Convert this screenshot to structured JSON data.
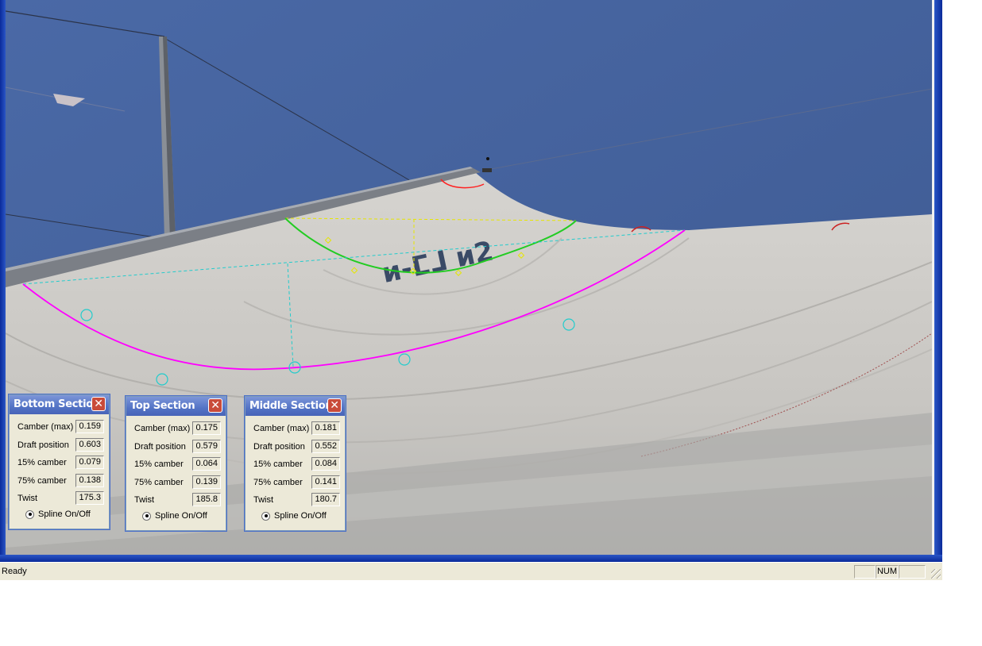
{
  "status_bar": {
    "text": "Ready",
    "panes": [
      "",
      "NUM",
      ""
    ]
  },
  "panels": {
    "bottom": {
      "title": "Bottom Section",
      "rows": [
        {
          "label": "Camber (max)",
          "value": "0.159"
        },
        {
          "label": "Draft position",
          "value": "0.603"
        },
        {
          "label": "15% camber",
          "value": "0.079"
        },
        {
          "label": "75% camber",
          "value": "0.138"
        },
        {
          "label": "Twist",
          "value": "175.3"
        }
      ],
      "spline_label": "Spline On/Off"
    },
    "top": {
      "title": "Top Section",
      "rows": [
        {
          "label": "Camber (max)",
          "value": "0.175"
        },
        {
          "label": "Draft position",
          "value": "0.579"
        },
        {
          "label": "15% camber",
          "value": "0.064"
        },
        {
          "label": "75% camber",
          "value": "0.139"
        },
        {
          "label": "Twist",
          "value": "185.8"
        }
      ],
      "spline_label": "Spline On/Off"
    },
    "middle": {
      "title": "Middle Section",
      "rows": [
        {
          "label": "Camber (max)",
          "value": "0.181"
        },
        {
          "label": "Draft position",
          "value": "0.552"
        },
        {
          "label": "15% camber",
          "value": "0.084"
        },
        {
          "label": "75% camber",
          "value": "0.141"
        },
        {
          "label": "Twist",
          "value": "180.7"
        }
      ],
      "spline_label": "Spline On/Off"
    }
  },
  "photo": {
    "sky_color": "#4d6aa3",
    "sail_color": "#cfcdc9",
    "bottom_curve_color": "#ff00ff",
    "top_curve_color": "#22cc22",
    "chord_color": "#22cccc",
    "top_chord_color": "#eeee00",
    "sail_logo_text": "ᴎ-ⵎ⅃ ᴎ2"
  }
}
